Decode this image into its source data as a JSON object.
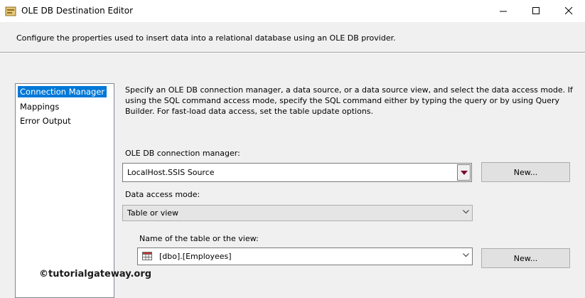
{
  "window": {
    "title": "OLE DB Destination Editor",
    "controls": [
      "minimize",
      "maximize",
      "close"
    ]
  },
  "description": "Configure the properties used to insert data into a relational database using an OLE DB provider.",
  "nav": {
    "items": [
      {
        "label": "Connection Manager",
        "selected": true
      },
      {
        "label": "Mappings",
        "selected": false
      },
      {
        "label": "Error Output",
        "selected": false
      }
    ]
  },
  "main": {
    "instructions": "Specify an OLE DB connection manager, a data source, or a data source view, and select the data access mode. If using the SQL command access mode, specify the SQL command either by typing the query or by using Query Builder. For fast-load data access, set the table update options.",
    "connection_manager": {
      "label": "OLE DB connection manager:",
      "value": "LocalHost.SSIS Source",
      "new_button": "New..."
    },
    "access_mode": {
      "label": "Data access mode:",
      "value": "Table or view"
    },
    "table": {
      "label": "Name of the table or the view:",
      "value": "[dbo].[Employees]",
      "new_button": "New..."
    }
  },
  "watermark": "©tutorialgateway.org",
  "colors": {
    "selection": "#0078d7",
    "dropdown_arrow": "#7a0a2a"
  }
}
